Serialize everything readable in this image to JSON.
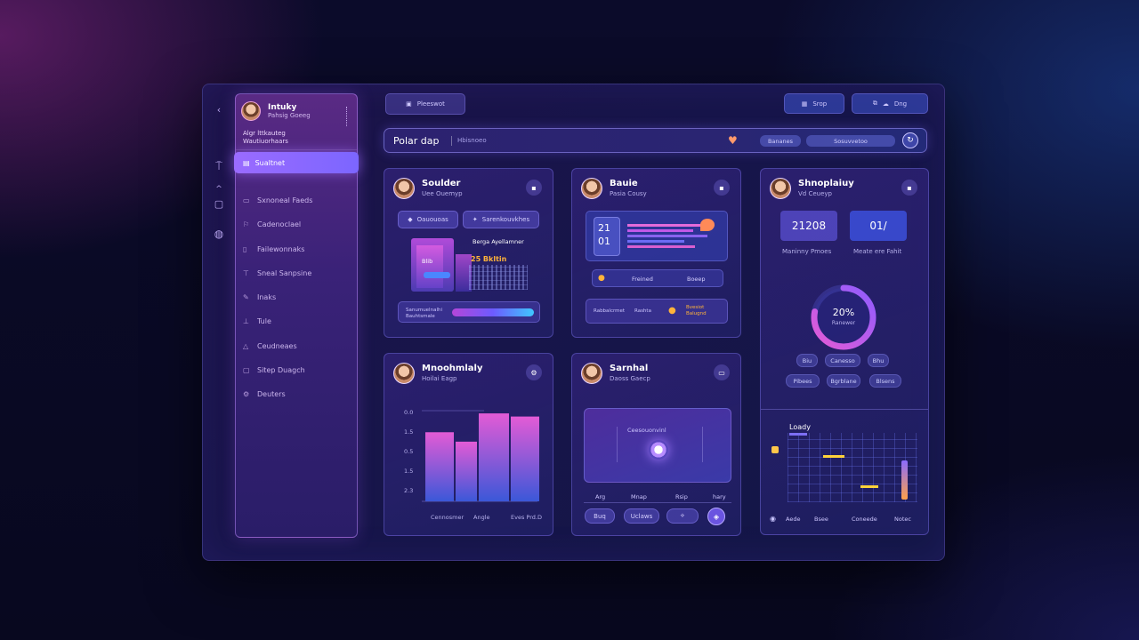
{
  "rail": {
    "icons": [
      "chevron-left-icon",
      "pin-icon",
      "caret-up-icon",
      "grid-icon",
      "globe-icon"
    ]
  },
  "sidebar": {
    "profile": {
      "name": "Intuky",
      "sub": "Pahsig Goeeg"
    },
    "meta": {
      "line1": "Algr lttkauteg",
      "line2": "Wautiuorhaars"
    },
    "active": "Sualtnet",
    "items": [
      {
        "label": "Sxnoneal Faeds",
        "icon": "folder-icon"
      },
      {
        "label": "Cadenoclael",
        "icon": "flag-icon"
      },
      {
        "label": "Failewonnaks",
        "icon": "document-icon"
      },
      {
        "label": "Sneal Sanpsine",
        "icon": "filter-icon"
      },
      {
        "label": "Inaks",
        "icon": "edit-icon"
      },
      {
        "label": "Tule",
        "icon": "text-icon"
      },
      {
        "label": "Ceudneaes",
        "icon": "bookmark-icon"
      },
      {
        "label": "Sitep Duagch",
        "icon": "box-icon"
      },
      {
        "label": "Deuters",
        "icon": "gear-icon"
      }
    ]
  },
  "topbar": {
    "left_pill": "Pleeswot",
    "right_pill_1": "Srop",
    "right_pill_2": "Dng"
  },
  "search": {
    "brand": "Polar dap",
    "hint": "Hbisnoeo",
    "chip1": "Bananes",
    "chip2": "Sosuvvetoo"
  },
  "cards": {
    "c1": {
      "title": "Soulder",
      "sub": "Uee Ouemyp",
      "btn1": "Oauouoas",
      "btn2": "Sarenkouvkhes",
      "chart_label": "Berga Ayellamner",
      "chart_value": "25 Bkltin",
      "tag": "Blib",
      "row_label": "Sanumuelnalhi Bauhtsmale"
    },
    "c2": {
      "title": "Bauie",
      "sub": "Pasia Cousy",
      "num1": "21",
      "num2": "01",
      "btn1": "Freined",
      "btn2": "Boeep",
      "row1": "Rabbalcrmet",
      "row2": "Rashta",
      "row3": "Bvesiot Balugnd"
    },
    "c3": {
      "title": "Shnoplaiuy",
      "sub": "Vd Ceueyp",
      "stat1": "21208",
      "stat2": "01/",
      "stat1_label": "Maninny Pmoes",
      "stat2_label": "Meate ere Fahit",
      "ring_value": "20%",
      "ring_sub": "Ranewer",
      "ring_fraction": 0.78,
      "chips": [
        "Biu",
        "Canesso",
        "Bhu",
        "Pibees",
        "Bgrblane",
        "Blsens"
      ],
      "lower_title": "Loady",
      "lower_axis": [
        "Aede",
        "Bsee",
        "Coneede",
        "Notec"
      ]
    },
    "c4": {
      "title": "Mnoohmlaly",
      "sub": "Hoilai Eagp",
      "yticks": [
        "0.0",
        "1.5",
        "0.5",
        "1.5",
        "2.3"
      ],
      "xlabels": [
        "Cennosmer",
        "Angle",
        "Eves Prd.D"
      ]
    },
    "c5": {
      "title": "Sarnhal",
      "sub": "Daoss Gaecp",
      "panel_label": "Ceesouonvinl",
      "axis": [
        "Arg",
        "Mnap",
        "Rsip",
        "hary"
      ],
      "btn1": "Buq",
      "btn2": "Uclaws"
    }
  },
  "chart_data": {
    "type": "bar",
    "categories": [
      "Cennosmer",
      "",
      "Angle",
      "Eves Prd.D"
    ],
    "values": [
      88,
      76,
      112,
      108
    ],
    "ylim": [
      0,
      120
    ]
  },
  "colors": {
    "accent": "#9a6bff",
    "pink": "#e35bd6",
    "blue": "#3b58d8"
  }
}
